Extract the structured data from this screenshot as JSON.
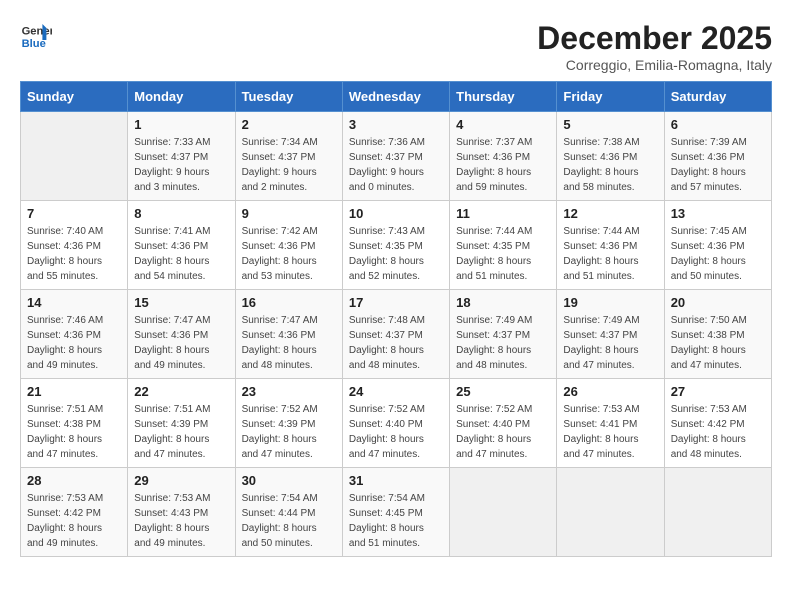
{
  "header": {
    "logo_line1": "General",
    "logo_line2": "Blue",
    "month_year": "December 2025",
    "location": "Correggio, Emilia-Romagna, Italy"
  },
  "days_of_week": [
    "Sunday",
    "Monday",
    "Tuesday",
    "Wednesday",
    "Thursday",
    "Friday",
    "Saturday"
  ],
  "weeks": [
    [
      {
        "day": "",
        "sunrise": "",
        "sunset": "",
        "daylight": ""
      },
      {
        "day": "1",
        "sunrise": "Sunrise: 7:33 AM",
        "sunset": "Sunset: 4:37 PM",
        "daylight": "Daylight: 9 hours and 3 minutes."
      },
      {
        "day": "2",
        "sunrise": "Sunrise: 7:34 AM",
        "sunset": "Sunset: 4:37 PM",
        "daylight": "Daylight: 9 hours and 2 minutes."
      },
      {
        "day": "3",
        "sunrise": "Sunrise: 7:36 AM",
        "sunset": "Sunset: 4:37 PM",
        "daylight": "Daylight: 9 hours and 0 minutes."
      },
      {
        "day": "4",
        "sunrise": "Sunrise: 7:37 AM",
        "sunset": "Sunset: 4:36 PM",
        "daylight": "Daylight: 8 hours and 59 minutes."
      },
      {
        "day": "5",
        "sunrise": "Sunrise: 7:38 AM",
        "sunset": "Sunset: 4:36 PM",
        "daylight": "Daylight: 8 hours and 58 minutes."
      },
      {
        "day": "6",
        "sunrise": "Sunrise: 7:39 AM",
        "sunset": "Sunset: 4:36 PM",
        "daylight": "Daylight: 8 hours and 57 minutes."
      }
    ],
    [
      {
        "day": "7",
        "sunrise": "Sunrise: 7:40 AM",
        "sunset": "Sunset: 4:36 PM",
        "daylight": "Daylight: 8 hours and 55 minutes."
      },
      {
        "day": "8",
        "sunrise": "Sunrise: 7:41 AM",
        "sunset": "Sunset: 4:36 PM",
        "daylight": "Daylight: 8 hours and 54 minutes."
      },
      {
        "day": "9",
        "sunrise": "Sunrise: 7:42 AM",
        "sunset": "Sunset: 4:36 PM",
        "daylight": "Daylight: 8 hours and 53 minutes."
      },
      {
        "day": "10",
        "sunrise": "Sunrise: 7:43 AM",
        "sunset": "Sunset: 4:35 PM",
        "daylight": "Daylight: 8 hours and 52 minutes."
      },
      {
        "day": "11",
        "sunrise": "Sunrise: 7:44 AM",
        "sunset": "Sunset: 4:35 PM",
        "daylight": "Daylight: 8 hours and 51 minutes."
      },
      {
        "day": "12",
        "sunrise": "Sunrise: 7:44 AM",
        "sunset": "Sunset: 4:36 PM",
        "daylight": "Daylight: 8 hours and 51 minutes."
      },
      {
        "day": "13",
        "sunrise": "Sunrise: 7:45 AM",
        "sunset": "Sunset: 4:36 PM",
        "daylight": "Daylight: 8 hours and 50 minutes."
      }
    ],
    [
      {
        "day": "14",
        "sunrise": "Sunrise: 7:46 AM",
        "sunset": "Sunset: 4:36 PM",
        "daylight": "Daylight: 8 hours and 49 minutes."
      },
      {
        "day": "15",
        "sunrise": "Sunrise: 7:47 AM",
        "sunset": "Sunset: 4:36 PM",
        "daylight": "Daylight: 8 hours and 49 minutes."
      },
      {
        "day": "16",
        "sunrise": "Sunrise: 7:47 AM",
        "sunset": "Sunset: 4:36 PM",
        "daylight": "Daylight: 8 hours and 48 minutes."
      },
      {
        "day": "17",
        "sunrise": "Sunrise: 7:48 AM",
        "sunset": "Sunset: 4:37 PM",
        "daylight": "Daylight: 8 hours and 48 minutes."
      },
      {
        "day": "18",
        "sunrise": "Sunrise: 7:49 AM",
        "sunset": "Sunset: 4:37 PM",
        "daylight": "Daylight: 8 hours and 48 minutes."
      },
      {
        "day": "19",
        "sunrise": "Sunrise: 7:49 AM",
        "sunset": "Sunset: 4:37 PM",
        "daylight": "Daylight: 8 hours and 47 minutes."
      },
      {
        "day": "20",
        "sunrise": "Sunrise: 7:50 AM",
        "sunset": "Sunset: 4:38 PM",
        "daylight": "Daylight: 8 hours and 47 minutes."
      }
    ],
    [
      {
        "day": "21",
        "sunrise": "Sunrise: 7:51 AM",
        "sunset": "Sunset: 4:38 PM",
        "daylight": "Daylight: 8 hours and 47 minutes."
      },
      {
        "day": "22",
        "sunrise": "Sunrise: 7:51 AM",
        "sunset": "Sunset: 4:39 PM",
        "daylight": "Daylight: 8 hours and 47 minutes."
      },
      {
        "day": "23",
        "sunrise": "Sunrise: 7:52 AM",
        "sunset": "Sunset: 4:39 PM",
        "daylight": "Daylight: 8 hours and 47 minutes."
      },
      {
        "day": "24",
        "sunrise": "Sunrise: 7:52 AM",
        "sunset": "Sunset: 4:40 PM",
        "daylight": "Daylight: 8 hours and 47 minutes."
      },
      {
        "day": "25",
        "sunrise": "Sunrise: 7:52 AM",
        "sunset": "Sunset: 4:40 PM",
        "daylight": "Daylight: 8 hours and 47 minutes."
      },
      {
        "day": "26",
        "sunrise": "Sunrise: 7:53 AM",
        "sunset": "Sunset: 4:41 PM",
        "daylight": "Daylight: 8 hours and 47 minutes."
      },
      {
        "day": "27",
        "sunrise": "Sunrise: 7:53 AM",
        "sunset": "Sunset: 4:42 PM",
        "daylight": "Daylight: 8 hours and 48 minutes."
      }
    ],
    [
      {
        "day": "28",
        "sunrise": "Sunrise: 7:53 AM",
        "sunset": "Sunset: 4:42 PM",
        "daylight": "Daylight: 8 hours and 49 minutes."
      },
      {
        "day": "29",
        "sunrise": "Sunrise: 7:53 AM",
        "sunset": "Sunset: 4:43 PM",
        "daylight": "Daylight: 8 hours and 49 minutes."
      },
      {
        "day": "30",
        "sunrise": "Sunrise: 7:54 AM",
        "sunset": "Sunset: 4:44 PM",
        "daylight": "Daylight: 8 hours and 50 minutes."
      },
      {
        "day": "31",
        "sunrise": "Sunrise: 7:54 AM",
        "sunset": "Sunset: 4:45 PM",
        "daylight": "Daylight: 8 hours and 51 minutes."
      },
      {
        "day": "",
        "sunrise": "",
        "sunset": "",
        "daylight": ""
      },
      {
        "day": "",
        "sunrise": "",
        "sunset": "",
        "daylight": ""
      },
      {
        "day": "",
        "sunrise": "",
        "sunset": "",
        "daylight": ""
      }
    ]
  ]
}
